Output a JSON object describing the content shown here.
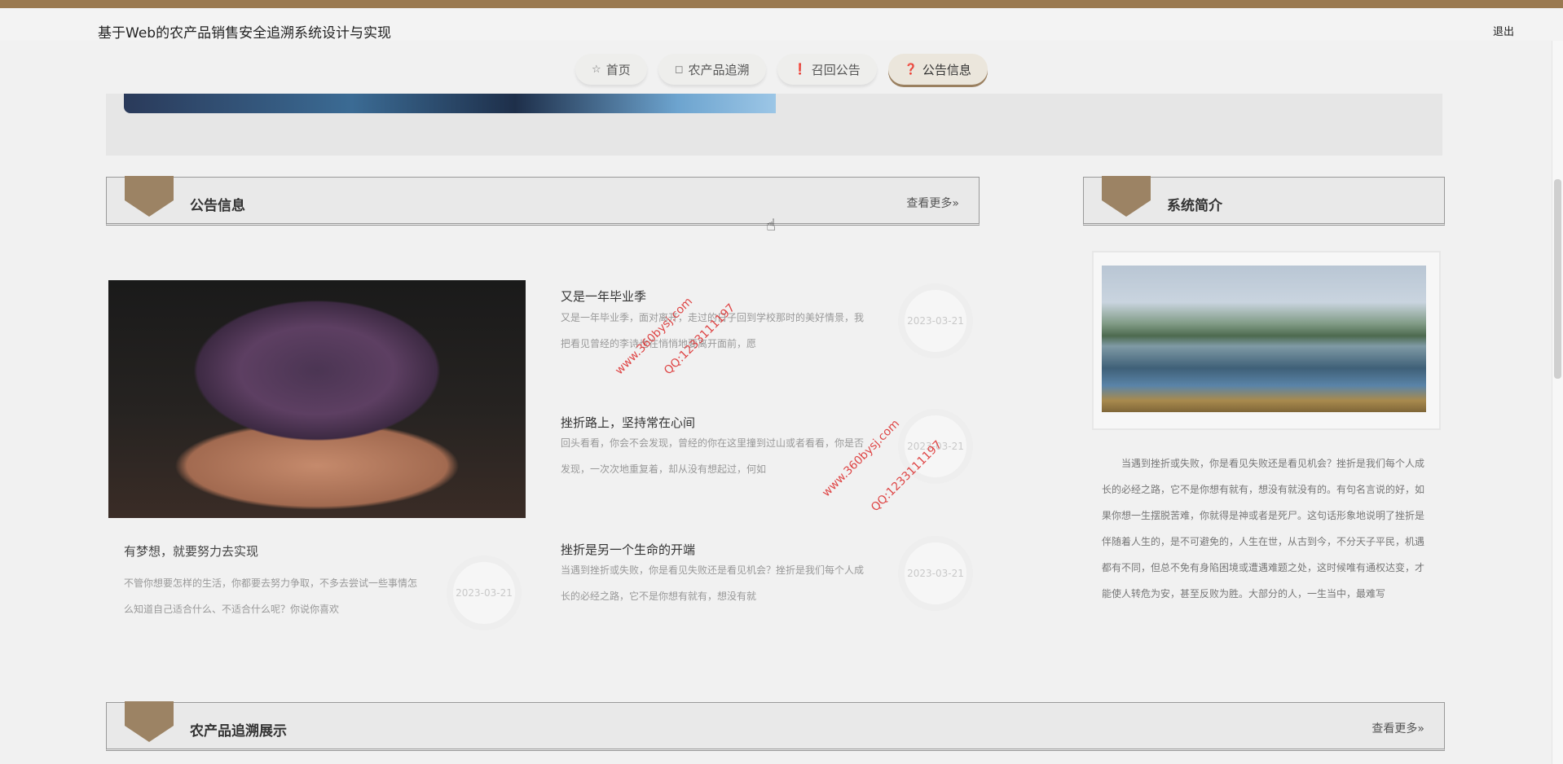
{
  "header": {
    "title": "基于Web的农产品销售安全追溯系统设计与实现",
    "logout": "退出"
  },
  "nav": [
    {
      "label": "首页",
      "icon": "star-outline-icon",
      "glyph": "☆"
    },
    {
      "label": "农产品追溯",
      "icon": "shopping-bag-icon",
      "glyph": "◻"
    },
    {
      "label": "召回公告",
      "icon": "exclamation-circle-icon",
      "glyph": "❗"
    },
    {
      "label": "公告信息",
      "icon": "question-circle-icon",
      "glyph": "❓"
    }
  ],
  "sections": {
    "announcements": {
      "title": "公告信息",
      "more": "查看更多»"
    },
    "intro": {
      "title": "系统简介"
    },
    "products": {
      "title": "农产品追溯展示",
      "more": "查看更多»"
    }
  },
  "feature": {
    "title": "有梦想，就要努力去实现",
    "desc": "不管你想要怎样的生活，你都要去努力争取，不多去尝试一些事情怎么知道自己适合什么、不适合什么呢？你说你喜欢",
    "date": "2023-03-21"
  },
  "news": [
    {
      "title": "又是一年毕业季",
      "desc": "又是一年毕业季，面对离开，走过的日子回到学校那时的美好情景，我把看见曾经的李诗也在悄悄地要离开面前，愿",
      "date": "2023-03-21"
    },
    {
      "title": "挫折路上，坚持常在心间",
      "desc": "回头看看，你会不会发现，曾经的你在这里撞到过山或者看看，你是否发现，一次次地重复着，却从没有想起过，何如",
      "date": "2023-03-21"
    },
    {
      "title": "挫折是另一个生命的开端",
      "desc": "当遇到挫折或失败，你是看见失败还是看见机会？挫折是我们每个人成长的必经之路，它不是你想有就有，想没有就",
      "date": "2023-03-21"
    }
  ],
  "intro": {
    "text": "当遇到挫折或失败，你是看见失败还是看见机会？挫折是我们每个人成长的必经之路，它不是你想有就有，想没有就没有的。有句名言说的好，如果你想一生摆脱苦难，你就得是神或者是死尸。这句话形象地说明了挫折是伴随着人生的，是不可避免的，人生在世，从古到今，不分天子平民，机遇都有不同，但总不免有身陷困境或遭遇难题之处，这时候唯有通权达变，才能使人转危为安，甚至反败为胜。大部分的人，一生当中，最难写"
  },
  "watermarks": [
    {
      "text": "www.360bysj.com"
    },
    {
      "text": "QQ:1233111197"
    },
    {
      "text": "www.360bysj.com"
    },
    {
      "text": "QQ:1233111197"
    }
  ]
}
